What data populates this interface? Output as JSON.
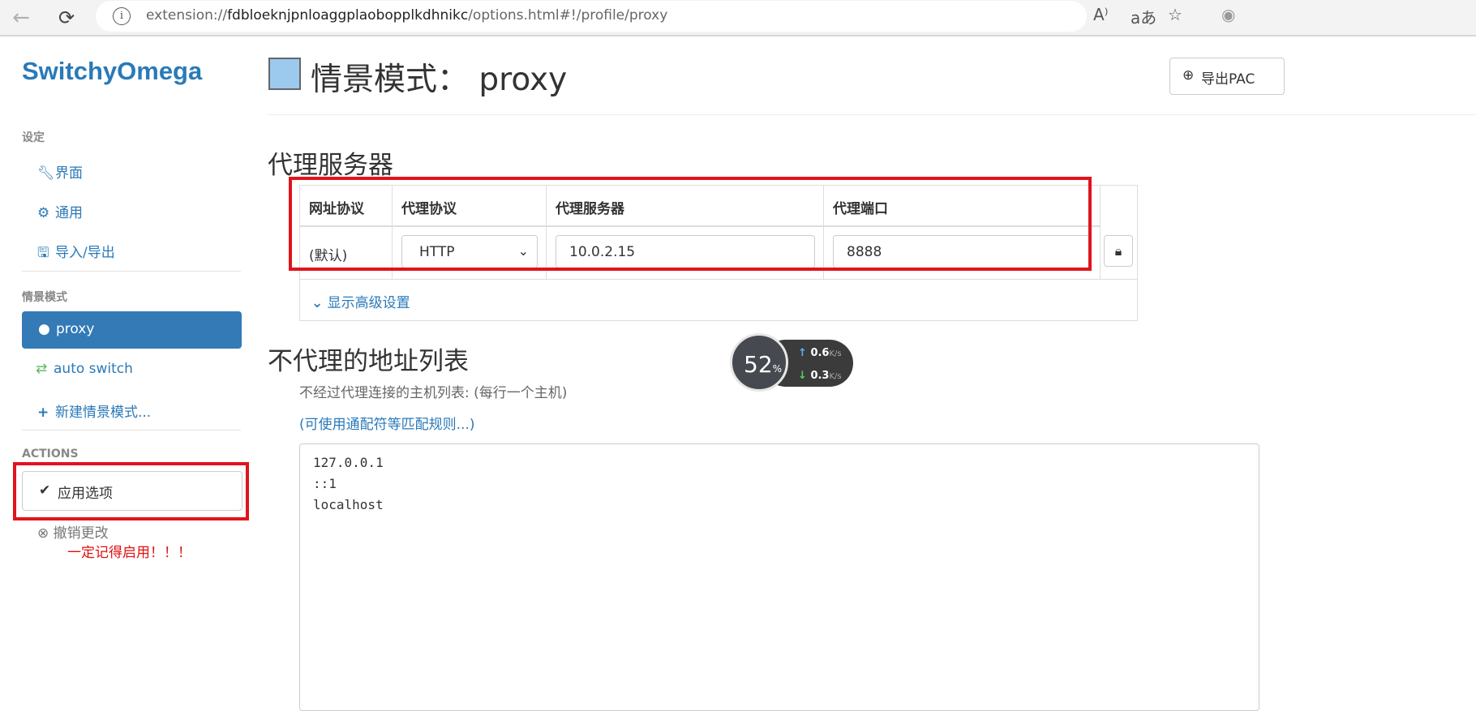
{
  "browser": {
    "url_prefix": "extension://",
    "url_host": "fdbloeknjpnloaggplaobopplkdhnikc",
    "url_path": "/options.html#!/profile/proxy"
  },
  "sidebar": {
    "brand": "SwitchyOmega",
    "settings_header": "设定",
    "settings_items": [
      {
        "label": "界面",
        "icon": "wrench-icon"
      },
      {
        "label": "通用",
        "icon": "gear-icon"
      },
      {
        "label": "导入/导出",
        "icon": "floppy-icon"
      }
    ],
    "profiles_header": "情景模式",
    "profiles": [
      {
        "label": "proxy",
        "icon": "globe-icon",
        "active": true
      },
      {
        "label": "auto switch",
        "icon": "retweet-icon"
      },
      {
        "label": "新建情景模式...",
        "icon": "plus-icon"
      }
    ],
    "actions_header": "ACTIONS",
    "apply_label": "应用选项",
    "undo_label": "撤销更改",
    "note": "一定记得启用！！！"
  },
  "header": {
    "title": "情景模式： proxy",
    "export_label": "导出PAC",
    "swatch_color": "#9cc9ee"
  },
  "proxy_section": {
    "title": "代理服务器",
    "columns": [
      "网址协议",
      "代理协议",
      "代理服务器",
      "代理端口"
    ],
    "row": {
      "scheme": "(默认)",
      "protocol": "HTTP",
      "server": "10.0.2.15",
      "port": "8888"
    },
    "advanced_label": "显示高级设置"
  },
  "bypass_section": {
    "title": "不代理的地址列表",
    "description": "不经过代理连接的主机列表: (每行一个主机)",
    "wildcard_link": "(可使用通配符等匹配规则...)",
    "entries": [
      "127.0.0.1",
      "::1",
      "localhost"
    ]
  },
  "speed_widget": {
    "percent": "52",
    "percent_unit": "%",
    "upload": "0.6",
    "download": "0.3",
    "unit": "K/s"
  },
  "colors": {
    "accent": "#337ab7",
    "highlight_box": "#e0141c",
    "note_text": "#e01010"
  }
}
